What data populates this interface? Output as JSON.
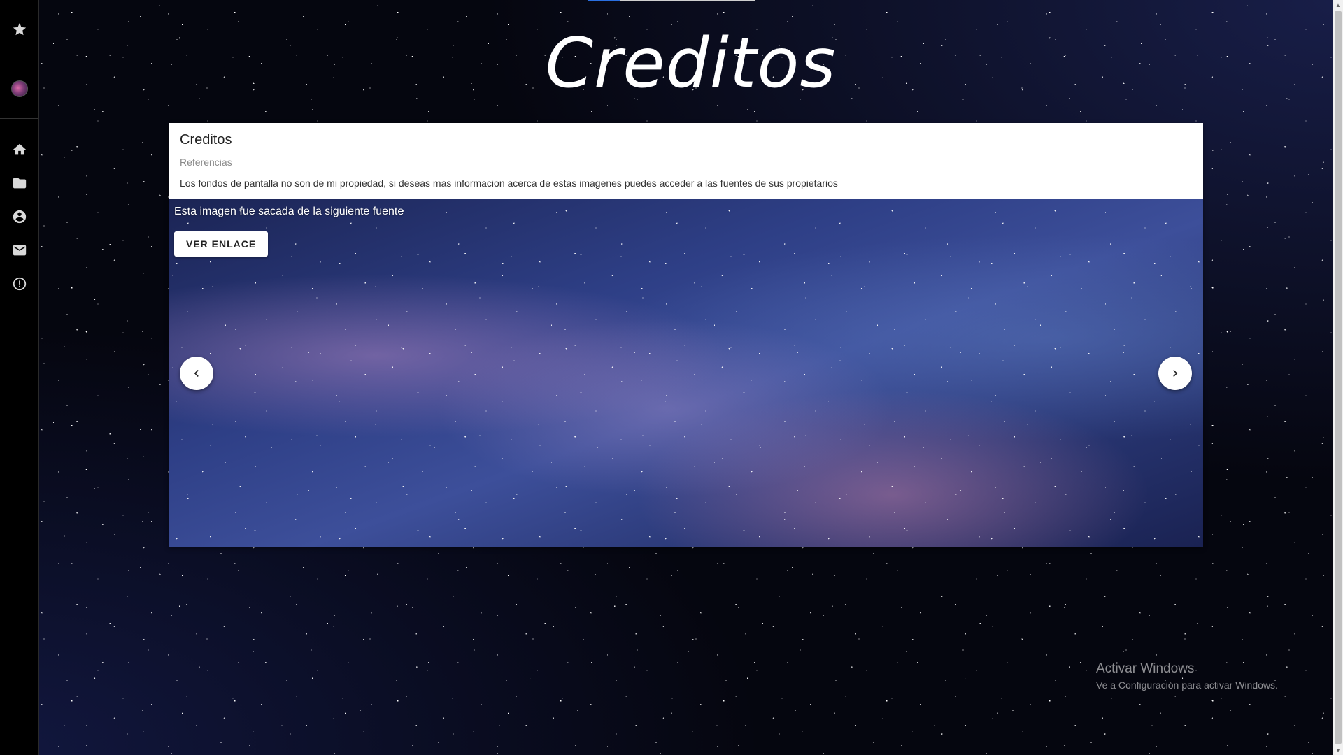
{
  "page": {
    "title": "Creditos"
  },
  "sidebar": {
    "top_icon": "star-icon",
    "avatar": "avatar",
    "items": [
      {
        "name": "home",
        "icon": "home-icon"
      },
      {
        "name": "folder",
        "icon": "folder-icon"
      },
      {
        "name": "account",
        "icon": "account-circle-icon"
      },
      {
        "name": "mail",
        "icon": "mail-icon"
      },
      {
        "name": "alert",
        "icon": "alert-circle-icon"
      }
    ]
  },
  "card": {
    "title": "Creditos",
    "subtitle": "Referencias",
    "text": "Los fondos de pantalla no son de mi propiedad, si deseas mas informacion acerca de estas imagenes puedes acceder a las fuentes de sus propietarios"
  },
  "carousel": {
    "caption": "Esta imagen fue sacada de la siguiente fuente",
    "button_label": "VER ENLACE",
    "prev_icon": "chevron-left-icon",
    "next_icon": "chevron-right-icon"
  },
  "watermark": {
    "title": "Activar Windows",
    "subtitle": "Ve a Configuración para activar Windows."
  },
  "colors": {
    "sidebar_bg": "#000000",
    "page_bg": "#05060f",
    "card_bg": "#ffffff",
    "accent": "#2a6fe0"
  }
}
